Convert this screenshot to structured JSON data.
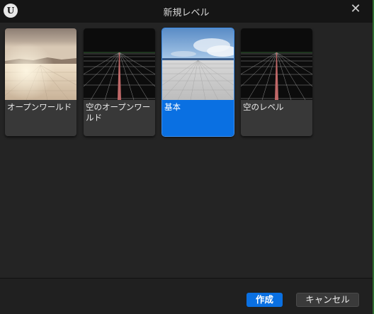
{
  "dialog": {
    "title": "新規レベル",
    "close_icon": "close-icon"
  },
  "templates": [
    {
      "id": "open-world",
      "label": "オープンワールド",
      "thumbnail": "sky-desert-tile-floor",
      "selected": false
    },
    {
      "id": "empty-open-world",
      "label": "空のオープンワールド",
      "thumbnail": "grid-horizon-dark",
      "selected": false
    },
    {
      "id": "basic",
      "label": "基本",
      "thumbnail": "blue-sky-tile-floor",
      "selected": true
    },
    {
      "id": "empty-level",
      "label": "空のレベル",
      "thumbnail": "grid-horizon-dark",
      "selected": false
    }
  ],
  "footer": {
    "create_label": "作成",
    "cancel_label": "キャンセル"
  },
  "colors": {
    "accent": "#0a70e2",
    "background": "#242424",
    "card": "#383838"
  }
}
